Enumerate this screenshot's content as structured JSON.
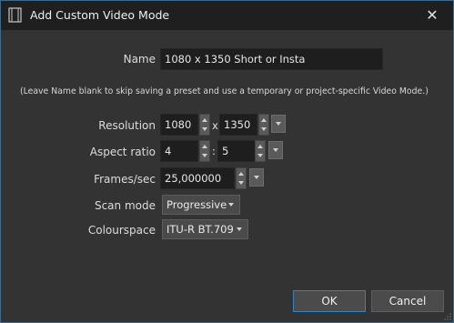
{
  "window": {
    "title": "Add Custom Video Mode",
    "app_icon": "film-strip-icon",
    "close_icon": "close-icon",
    "close_glyph": "✕"
  },
  "name": {
    "label": "Name",
    "value": "1080 x 1350 Short or Insta"
  },
  "hint": "(Leave Name blank to skip saving a preset and use a temporary or project-specific Video Mode.)",
  "resolution": {
    "label": "Resolution",
    "width": "1080",
    "separator": "x",
    "height": "1350"
  },
  "aspect_ratio": {
    "label": "Aspect ratio",
    "numerator": "4",
    "separator": ":",
    "denominator": "5"
  },
  "frames_per_sec": {
    "label": "Frames/sec",
    "value": "25,000000"
  },
  "scan_mode": {
    "label": "Scan mode",
    "value": "Progressive"
  },
  "colourspace": {
    "label": "Colourspace",
    "value": "ITU-R BT.709"
  },
  "buttons": {
    "ok": "OK",
    "cancel": "Cancel"
  },
  "colors": {
    "accent": "#3d7fb8",
    "background": "#333333",
    "titlebar": "#1f1f1f"
  }
}
